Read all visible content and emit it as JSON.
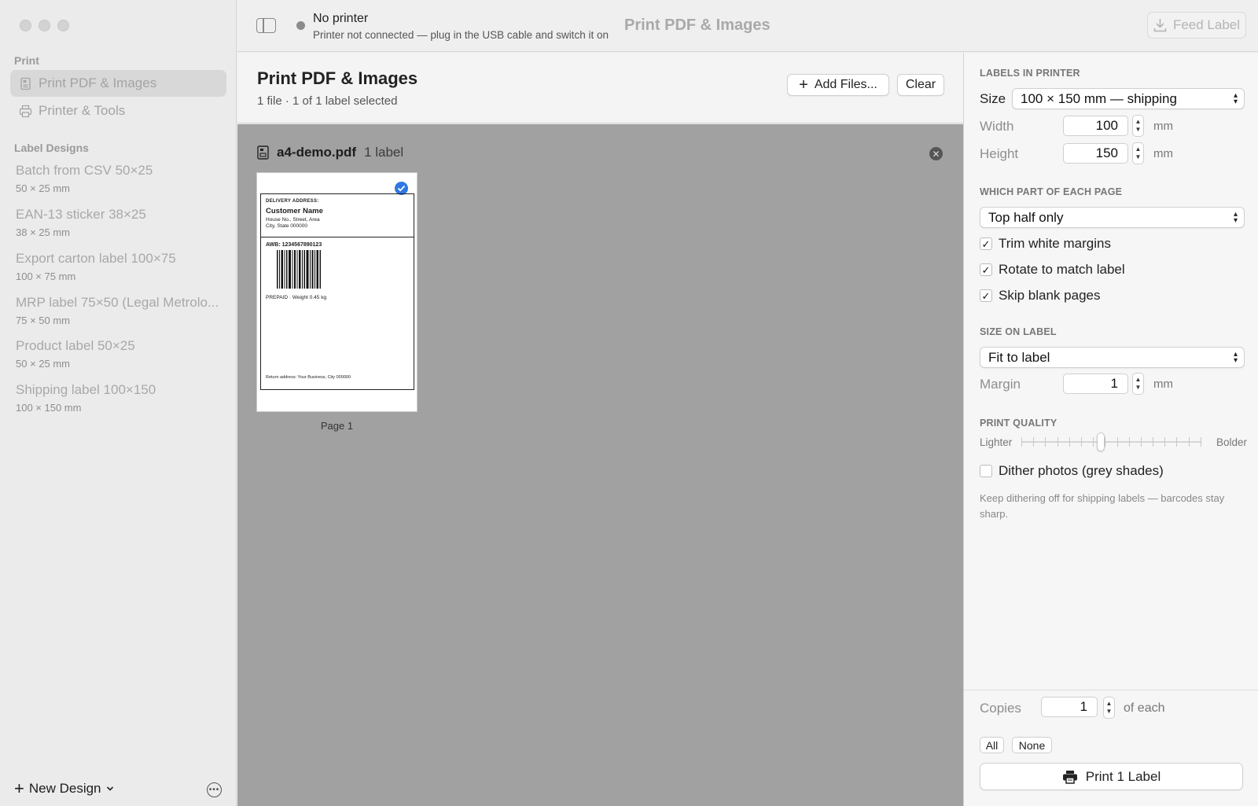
{
  "sidebar": {
    "print_section": "Print",
    "nav": [
      {
        "label": "Print PDF & Images"
      },
      {
        "label": "Printer & Tools"
      }
    ],
    "designs_section": "Label Designs",
    "designs": [
      {
        "name": "Batch from CSV 50×25",
        "size": "50 × 25 mm"
      },
      {
        "name": "EAN-13 sticker 38×25",
        "size": "38 × 25 mm"
      },
      {
        "name": "Export carton label 100×75",
        "size": "100 × 75 mm"
      },
      {
        "name": "MRP label 75×50 (Legal Metrolo...",
        "size": "75 × 50 mm"
      },
      {
        "name": "Product label 50×25",
        "size": "50 × 25 mm"
      },
      {
        "name": "Shipping label 100×150",
        "size": "100 × 150 mm"
      }
    ],
    "new_design_label": "New Design"
  },
  "toolbar": {
    "status_title": "No printer",
    "status_sub": "Printer not connected — plug in the USB cable and switch it on",
    "window_title": "Print PDF & Images",
    "feed_label": "Feed Label",
    "status_color": "#8b8b8b"
  },
  "header": {
    "title": "Print PDF & Images",
    "subtitle": "1 file · 1 of 1 label selected",
    "add_files_label": "Add Files...",
    "clear_label": "Clear"
  },
  "canvas": {
    "file_name": "a4-demo.pdf",
    "file_count": "1 label",
    "page_label": "Page 1",
    "preview": {
      "delivery_heading": "DELIVERY ADDRESS:",
      "customer_name": "Customer Name",
      "address_line1": "House No., Street, Area",
      "address_line2": "City, State 000000",
      "awb": "AWB: 1234567890123",
      "prepaid": "PREPAID  ·  Weight 0.45 kg",
      "return_address": "Return address: Your Business, City 000000"
    },
    "selected_color": "#2f78e4"
  },
  "inspector": {
    "labels_section": "LABELS IN PRINTER",
    "size_label": "Size",
    "size_value": "100 × 150 mm — shipping",
    "width_label": "Width",
    "width_value": "100",
    "height_label": "Height",
    "height_value": "150",
    "unit": "mm",
    "part_section": "WHICH PART OF EACH PAGE",
    "part_value": "Top half only",
    "trim_label": "Trim white margins",
    "rotate_label": "Rotate to match label",
    "skip_label": "Skip blank pages",
    "size_on_section": "SIZE ON LABEL",
    "fit_value": "Fit to label",
    "margin_label": "Margin",
    "margin_value": "1",
    "quality_section": "PRINT QUALITY",
    "lighter_label": "Lighter",
    "bolder_label": "Bolder",
    "quality_level": 0.44,
    "dither_label": "Dither photos (grey shades)",
    "help_text": "Keep dithering off for shipping labels — barcodes stay sharp.",
    "copies_label": "Copies",
    "copies_value": "1",
    "of_each_label": "of each",
    "all_label": "All",
    "none_label": "None",
    "print_label": "Print 1 Label"
  }
}
